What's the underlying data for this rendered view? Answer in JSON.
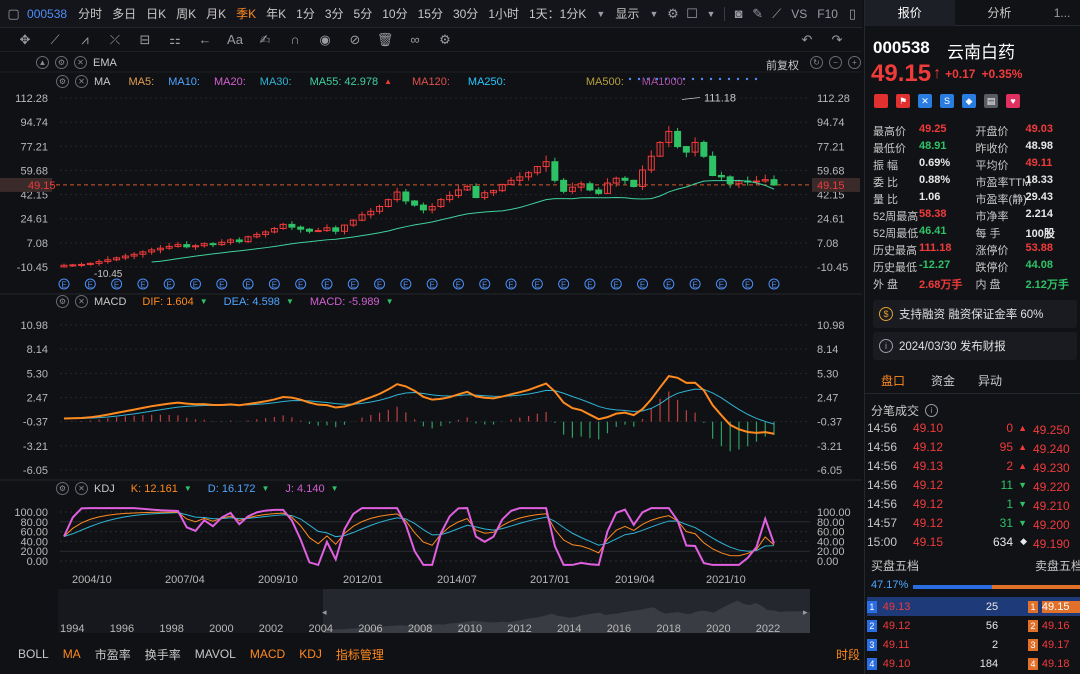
{
  "topbar": {
    "code": "000538",
    "timeframes": [
      "分时",
      "多日",
      "日K",
      "周K",
      "月K",
      "季K",
      "年K",
      "1分",
      "3分",
      "5分",
      "10分",
      "15分",
      "30分",
      "1小时"
    ],
    "active_index": 5,
    "period_select": "1天：1分K",
    "display": "显示",
    "vs_label": "VS",
    "f10_label": "F10"
  },
  "chart": {
    "ema_label": "EMA",
    "restore_label": "前复权",
    "ma": {
      "name": "MA",
      "ma5": "MA5:",
      "ma10": "MA10:",
      "ma20": "MA20:",
      "ma30": "MA30:",
      "ma55": "MA55: 42.978",
      "ma120": "MA120:",
      "ma250": "MA250:",
      "ma500": "MA500:",
      "ma1000": "MA1000:"
    },
    "y_ticks": [
      "112.28",
      "94.74",
      "77.21",
      "59.68",
      "42.15",
      "24.61",
      "7.08",
      "-10.45"
    ],
    "current_price_tag": "49.15",
    "high_label": "111.18",
    "low_label": "-10.45",
    "macd": {
      "name": "MACD",
      "dif": "DIF: 1.604",
      "dea": "DEA: 4.598",
      "macd": "MACD: -5.989"
    },
    "macd_ticks": [
      "10.98",
      "8.14",
      "5.30",
      "2.47",
      "-0.37",
      "-3.21",
      "-6.05"
    ],
    "kdj": {
      "name": "KDJ",
      "k": "K: 12.161",
      "d": "D: 16.172",
      "j": "J: 4.140"
    },
    "kdj_ticks": [
      "100.00",
      "80.00",
      "60.00",
      "40.00",
      "20.00",
      "0.00"
    ],
    "x_labels": [
      "2004/10",
      "2007/04",
      "2009/10",
      "2012/01",
      "2014/07",
      "2017/01",
      "2019/04",
      "2021/10"
    ],
    "nav_years": [
      "1994",
      "1996",
      "1998",
      "2000",
      "2002",
      "2004",
      "2006",
      "2008",
      "2010",
      "2012",
      "2014",
      "2016",
      "2018",
      "2020",
      "2022"
    ]
  },
  "chart_data": {
    "type": "candlestick",
    "title": "000538 云南白药 季K",
    "ylim": [
      -10.45,
      112.28
    ],
    "close": [
      -9.2,
      -8.9,
      -8.6,
      -7.8,
      -6.5,
      -5.2,
      -3.8,
      -2.5,
      -1.2,
      0.5,
      2.0,
      3.2,
      4.5,
      5.8,
      4.2,
      5.0,
      6.5,
      5.8,
      7.5,
      9.2,
      8.0,
      11.5,
      13.2,
      15.0,
      17.5,
      20.5,
      18.5,
      17.0,
      15.5,
      16.0,
      18.0,
      15.5,
      20.0,
      23.5,
      27.5,
      30.0,
      33.5,
      38.5,
      44.0,
      37.5,
      34.5,
      31.0,
      33.5,
      38.5,
      41.5,
      45.5,
      48.0,
      40.0,
      43.5,
      45.0,
      49.5,
      52.5,
      55.0,
      58.0,
      62.5,
      66.0,
      52.5,
      44.5,
      47.5,
      50.0,
      45.5,
      43.0,
      50.5,
      54.0,
      52.5,
      48.0,
      60.0,
      70.0,
      80.0,
      88.0,
      77.0,
      73.0,
      80.0,
      70.0,
      56.0,
      55.0,
      50.0,
      52.0,
      51.5,
      52.0,
      53.0,
      49.15
    ],
    "macd_dif_final": 1.604,
    "macd_dea_final": 4.598,
    "macd_hist_final": -5.989,
    "k_final": 12.161,
    "d_final": 16.172,
    "j_final": 4.14
  },
  "bottom_tabs": [
    "BOLL",
    "MA",
    "市盈率",
    "换手率",
    "MAVOL",
    "MACD",
    "KDJ",
    "指标管理"
  ],
  "bottom_right": "时段",
  "quote": {
    "tabs": [
      "报价",
      "分析"
    ],
    "code": "000538",
    "name": "云南白药",
    "price": "49.15",
    "arrow": "↑",
    "change": "+0.17",
    "pct": "+0.35%",
    "rows": [
      [
        [
          "最高价",
          "49.25",
          "red"
        ],
        [
          "开盘价",
          "49.03",
          "red"
        ]
      ],
      [
        [
          "最低价",
          "48.91",
          "green"
        ],
        [
          "昨收价",
          "48.98",
          "white"
        ]
      ],
      [
        [
          "振  幅",
          "0.69%",
          "white"
        ],
        [
          "平均价",
          "49.11",
          "red"
        ]
      ],
      [
        [
          "委  比",
          "0.88%",
          "white"
        ],
        [
          "市盈率TTM",
          "18.33",
          "white"
        ]
      ],
      [
        [
          "量  比",
          "1.06",
          "white"
        ],
        [
          "市盈率(静)",
          "29.43",
          "white"
        ]
      ],
      [
        [
          "52周最高",
          "58.38",
          "red"
        ],
        [
          "市净率",
          "2.214",
          "white"
        ]
      ],
      [
        [
          "52周最低",
          "46.41",
          "green"
        ],
        [
          "每  手",
          "100股",
          "white"
        ]
      ],
      [
        [
          "历史最高",
          "111.18",
          "red"
        ],
        [
          "涨停价",
          "53.88",
          "red"
        ]
      ],
      [
        [
          "历史最低",
          "-12.27",
          "green"
        ],
        [
          "跌停价",
          "44.08",
          "green"
        ]
      ],
      [
        [
          "外  盘",
          "2.68万手",
          "red"
        ],
        [
          "内  盘",
          "2.12万手",
          "green"
        ]
      ]
    ],
    "notice1": "支持融资 融资保证金率 60%",
    "notice2": "2024/03/30  发布财报",
    "subtabs": [
      "盘口",
      "资金",
      "异动"
    ],
    "ticks_title": "分笔成交",
    "ticks": [
      [
        "14:56",
        "49.10",
        "0",
        "▲",
        "red",
        "red"
      ],
      [
        "14:56",
        "49.12",
        "95",
        "▲",
        "red",
        "red"
      ],
      [
        "14:56",
        "49.13",
        "2",
        "▲",
        "red",
        "red"
      ],
      [
        "14:56",
        "49.12",
        "11",
        "▼",
        "red",
        "green"
      ],
      [
        "14:56",
        "49.12",
        "1",
        "▼",
        "red",
        "green"
      ],
      [
        "14:57",
        "49.12",
        "31",
        "▼",
        "red",
        "green"
      ],
      [
        "15:00",
        "49.15",
        "634",
        "◆",
        "red",
        "white"
      ]
    ],
    "price_ladder": [
      "49.250",
      "49.240",
      "49.230",
      "49.220",
      "49.210",
      "49.200",
      "49.190"
    ],
    "buy_title": "买盘五档",
    "sell_title": "卖盘五档",
    "buy_pct": "47.17%",
    "buy_ratio": 0.4717,
    "buy": [
      [
        "1",
        "49.13",
        "25"
      ],
      [
        "2",
        "49.12",
        "56"
      ],
      [
        "3",
        "49.11",
        "2"
      ],
      [
        "4",
        "49.10",
        "184"
      ]
    ],
    "sell": [
      "49.15",
      "49.16",
      "49.17",
      "49.18"
    ]
  }
}
